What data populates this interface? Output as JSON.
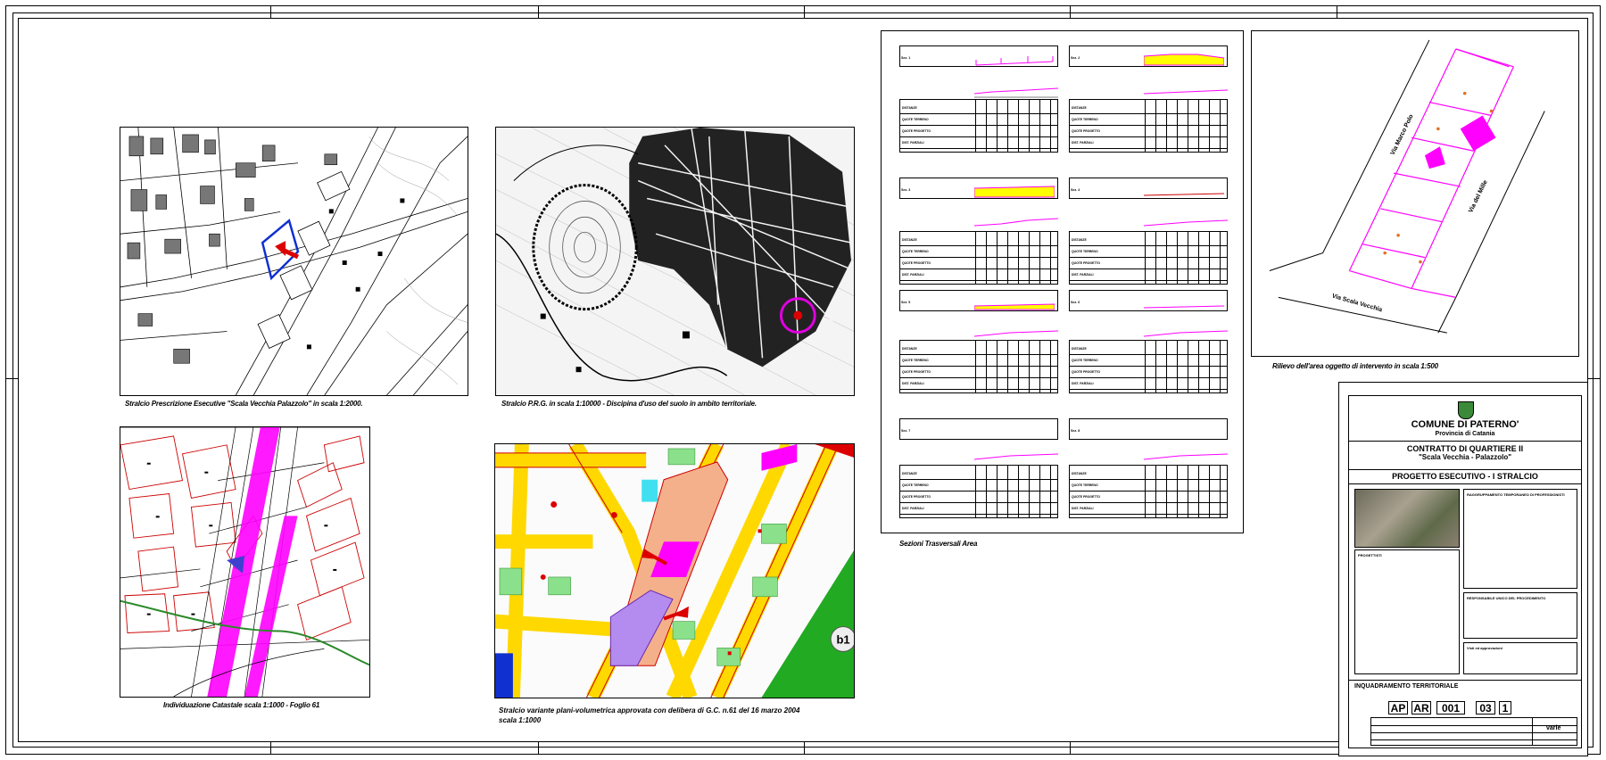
{
  "captions": {
    "plan1": "Stralcio  Prescrizione Esecutive \"Scala Vecchia Palazzolo\"  in scala 1:2000.",
    "plan2": "Stralcio P.R.G. in scala 1:10000 - Discipina d'uso del suolo in ambito territoriale.",
    "plan3": "Individuazione Catastale scala 1:1000 - Foglio 61",
    "plan4_line1": "Stralcio variante plani-volumetrica approvata con delibera di G.C. n.61 del  16 marzo 2004",
    "plan4_line2": "scala 1:1000",
    "sections": "Sezioni Trasversali Area",
    "survey": "Rilievo dell'area oggetto di intervento in scala 1:500"
  },
  "map_labels": {
    "survey_road1": "Via Marco Polo",
    "survey_road2": "Via del Mille",
    "survey_road3": "Via Scala Vecchia",
    "variant_zone": "b1"
  },
  "sections": {
    "titles": [
      "Sez. 1",
      "Sez. 2",
      "Sez. 3",
      "Sez. 4",
      "Sez. 5",
      "Sez. 6",
      "Sez. 7",
      "Sez. 8"
    ],
    "row_labels": [
      "DISTANZE",
      "QUOTE TERRENO",
      "QUOTE PROGETTO",
      "DIST. PARZIALI"
    ]
  },
  "title_block": {
    "comune": "COMUNE DI PATERNO'",
    "provincia": "Provincia di Catania",
    "contratto": "CONTRATTO DI QUARTIERE II",
    "progetto_nome": "\"Scala Vecchia - Palazzolo\"",
    "fase": "PROGETTO ESECUTIVO - I STRALCIO",
    "raggruppamento": "RAGGRUPPAMENTO TEMPORANEO DI PROFESSIONISTI",
    "progettisti": "PROGETTISTI",
    "responsabile": "RESPONSABILE UNICO DEL PROCEDIMENTO",
    "visti": "Visti ed approvazioni",
    "tavola": "INQUADRAMENTO TERRITORIALE",
    "codes": [
      "AP",
      "AR",
      "001",
      "03",
      "1"
    ],
    "scala": "varie"
  },
  "colors": {
    "magenta": "#ff00ff",
    "red": "#cc0000",
    "yellow": "#ffff00",
    "green": "#8be08b",
    "blue": "#1030d0",
    "orange": "#f4b08a"
  }
}
